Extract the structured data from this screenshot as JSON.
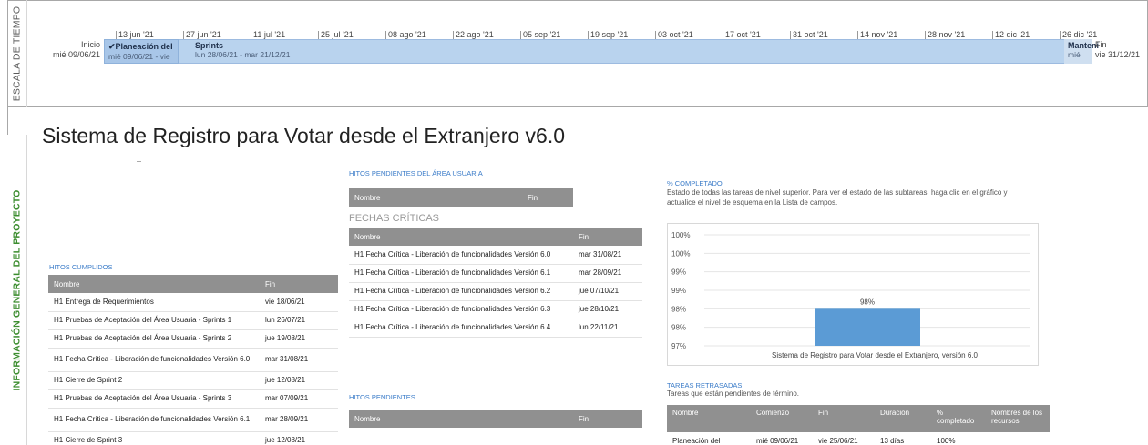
{
  "side_labels": {
    "timescale": "ESCALA DE TIEMPO",
    "project_info": "INFORMACIÓN GENERAL DEL PROYECTO"
  },
  "timeline": {
    "ticks": [
      "13 jun '21",
      "27 jun '21",
      "11 jul '21",
      "25 jul '21",
      "08 ago '21",
      "22 ago '21",
      "05 sep '21",
      "19 sep '21",
      "03 oct '21",
      "17 oct '21",
      "31 oct '21",
      "14 nov '21",
      "28 nov '21",
      "12 dic '21",
      "26 dic '21"
    ],
    "start_label": "Inicio",
    "start_date": "mié 09/06/21",
    "end_label": "Fin",
    "end_date": "vie 31/12/21",
    "segments": [
      {
        "title": "✔Planeación del",
        "dates": "mié 09/06/21 - vie"
      },
      {
        "title": "Sprints",
        "dates": "lun 28/06/21 - mar 21/12/21"
      },
      {
        "title": "Manteni",
        "dates": "mié"
      }
    ]
  },
  "project_title": "Sistema de Registro para Votar desde el Extranjero v6.0",
  "hitos_cumplidos": {
    "label": "HITOS CUMPLIDOS",
    "headers": [
      "Nombre",
      "Fin"
    ],
    "rows": [
      [
        "H1 Entrega de Requerimientos",
        "vie 18/06/21"
      ],
      [
        "H1 Pruebas de Aceptación del Área Usuaria - Sprints 1",
        "lun 26/07/21"
      ],
      [
        "H1 Pruebas de Aceptación del Área Usuaria - Sprints 2",
        "jue 19/08/21"
      ],
      [
        "H1 Fecha Crítica - Liberación de funcionalidades Versión 6.0",
        "mar 31/08/21"
      ],
      [
        "H1 Cierre de Sprint 2",
        "jue 12/08/21"
      ],
      [
        "H1 Pruebas de Aceptación del Área Usuaria - Sprints 3",
        "mar 07/09/21"
      ],
      [
        "H1 Fecha Crítica - Liberación de funcionalidades Versión 6.1",
        "mar 28/09/21"
      ],
      [
        "H1 Cierre de Sprint 3",
        "jue 12/08/21"
      ]
    ]
  },
  "hitos_pendientes_area": {
    "label": "HITOS PENDIENTES DEL ÁREA USUARIA",
    "headers": [
      "Nombre",
      "Fin"
    ]
  },
  "fechas_criticas": {
    "label": "FECHAS CRÍTICAS",
    "headers": [
      "Nombre",
      "Fin"
    ],
    "rows": [
      [
        "H1 Fecha Crítica - Liberación de funcionalidades Versión 6.0",
        "mar 31/08/21"
      ],
      [
        "H1 Fecha Crítica - Liberación de funcionalidades Versión 6.1",
        "mar 28/09/21"
      ],
      [
        "H1 Fecha Crítica - Liberación de funcionalidades Versión 6.2",
        "jue 07/10/21"
      ],
      [
        "H1 Fecha Crítica - Liberación de funcionalidades Versión 6.3",
        "jue 28/10/21"
      ],
      [
        "H1 Fecha Crítica - Liberación de funcionalidades Versión 6.4",
        "lun 22/11/21"
      ]
    ]
  },
  "hitos_pendientes": {
    "label": "HITOS PENDIENTES",
    "headers": [
      "Nombre",
      "Fin"
    ]
  },
  "completado": {
    "label": "% COMPLETADO",
    "description": "Estado de todas las tareas de nivel superior. Para ver el estado de las subtareas, haga clic en el gráfico y actualice el nivel de esquema en la Lista de campos."
  },
  "chart_data": {
    "type": "bar",
    "categories": [
      "Sistema de Registro para Votar desde el Extranjero, versión 6.0"
    ],
    "values": [
      98
    ],
    "data_labels": [
      "98%"
    ],
    "y_tick_labels": [
      "100%",
      "100%",
      "99%",
      "99%",
      "98%",
      "98%",
      "97%"
    ],
    "ylim": [
      97,
      100
    ],
    "grid": true,
    "bar_color": "#5b9bd5"
  },
  "tareas_retrasadas": {
    "label": "TAREAS RETRASADAS",
    "description": "Tareas que están pendientes de término.",
    "headers": [
      "Nombre",
      "Comienzo",
      "Fin",
      "Duración",
      "% completado",
      "Nombres de los recursos"
    ],
    "rows": [
      [
        "Planeación del",
        "mié 09/06/21",
        "vie 25/06/21",
        "13 días",
        "100%",
        ""
      ]
    ]
  }
}
